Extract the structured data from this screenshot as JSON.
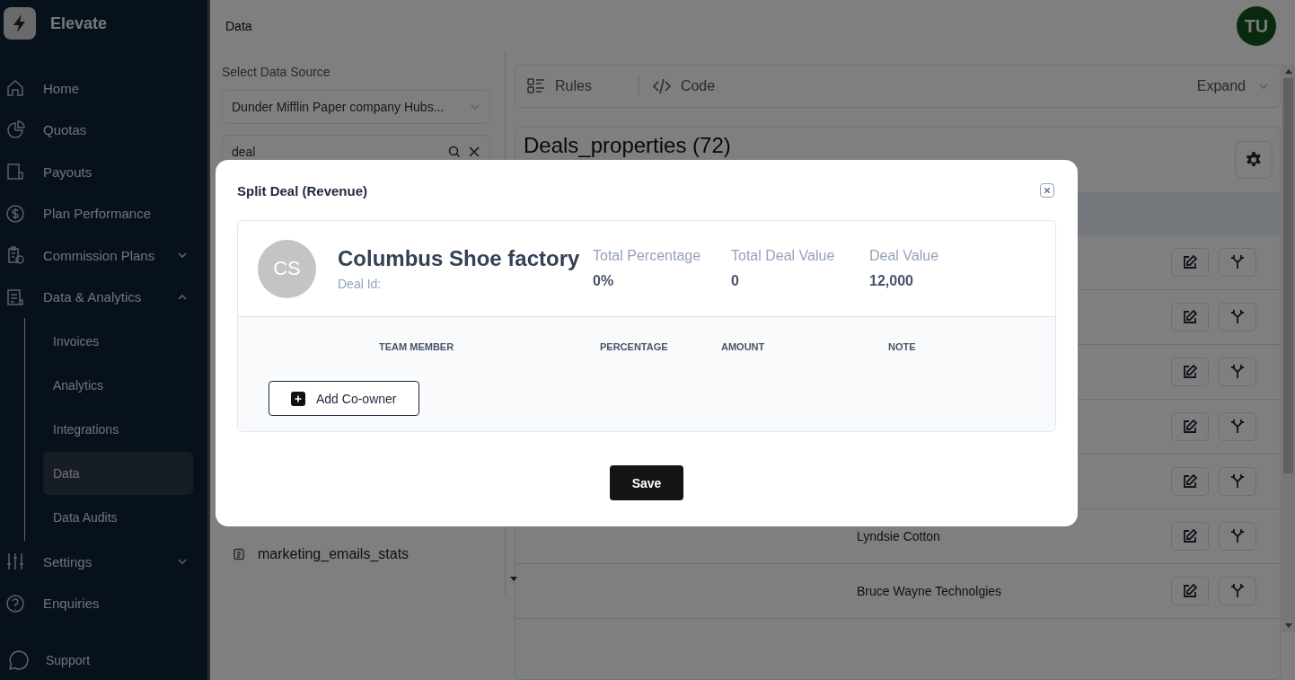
{
  "app": {
    "name": "Elevate"
  },
  "sidebar": {
    "items": [
      {
        "label": "Home",
        "selected": false
      },
      {
        "label": "Quotas",
        "selected": false
      },
      {
        "label": "Payouts",
        "selected": false
      },
      {
        "label": "Plan Performance",
        "selected": false
      },
      {
        "label": "Commission Plans",
        "selected": false,
        "expanded": false
      },
      {
        "label": "Data & Analytics",
        "selected": false,
        "expanded": true,
        "children": [
          {
            "label": "Invoices",
            "selected": false
          },
          {
            "label": "Analytics",
            "selected": false
          },
          {
            "label": "Integrations",
            "selected": false
          },
          {
            "label": "Data",
            "selected": true
          },
          {
            "label": "Data Audits",
            "selected": false
          }
        ]
      },
      {
        "label": "Settings",
        "selected": false,
        "expanded": false
      },
      {
        "label": "Enquiries",
        "selected": false
      }
    ],
    "support": "Support"
  },
  "header": {
    "title": "Data",
    "avatar": "TU"
  },
  "data_source": {
    "label": "Select Data Source",
    "value": "Dunder Mifflin Paper company Hubs...",
    "search": "deal",
    "objects": [
      "marketing_emails_stats"
    ]
  },
  "toolbar": {
    "tabs": [
      {
        "label": "Rules"
      },
      {
        "label": "Code"
      }
    ],
    "expand": "Expand"
  },
  "table": {
    "title": "Deals_properties (72)",
    "rows": [
      {},
      {},
      {},
      {},
      {},
      {
        "name": "Lyndsie Cotton"
      },
      {
        "name": "Bruce Wayne Technolgies"
      }
    ]
  },
  "modal": {
    "title": "Split Deal (Revenue)",
    "initials": "CS",
    "deal_name": "Columbus Shoe factory",
    "deal_id_label": "Deal Id:",
    "stats": [
      {
        "label": "Total Percentage",
        "value": "0%"
      },
      {
        "label": "Total Deal Value",
        "value": "0"
      },
      {
        "label": "Deal Value",
        "value": "12,000"
      }
    ],
    "columns": [
      "TEAM MEMBER",
      "PERCENTAGE",
      "AMOUNT",
      "NOTE"
    ],
    "add_button": "Add Co-owner",
    "save_button": "Save"
  }
}
